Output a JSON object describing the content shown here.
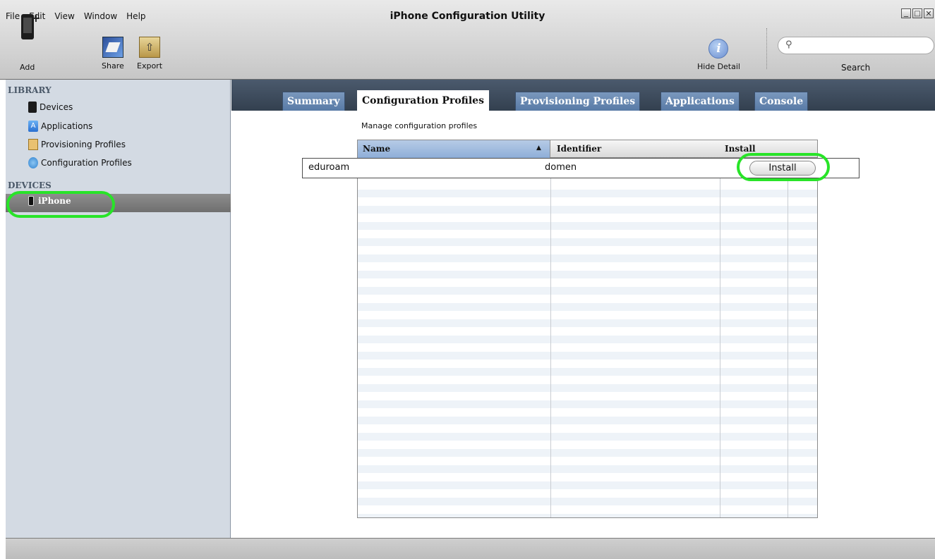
{
  "app": {
    "title": "iPhone Configuration Utility"
  },
  "menu": [
    "File",
    "Edit",
    "View",
    "Window",
    "Help"
  ],
  "toolbar": {
    "add_label": "Add",
    "share_label": "Share",
    "export_label": "Export",
    "hide_detail_label": "Hide Detail",
    "search_label": "Search",
    "search_value": ""
  },
  "sidebar": {
    "library_header": "LIBRARY",
    "library_items": [
      {
        "label": "Devices",
        "icon": "device-icon"
      },
      {
        "label": "Applications",
        "icon": "app-store-icon"
      },
      {
        "label": "Provisioning Profiles",
        "icon": "provisioning-profile-icon"
      },
      {
        "label": "Configuration Profiles",
        "icon": "configuration-profile-icon"
      }
    ],
    "devices_header": "DEVICES",
    "devices": [
      {
        "label": "iPhone",
        "icon": "iphone-icon",
        "selected": true
      }
    ]
  },
  "tabs": [
    {
      "label": "Summary",
      "active": false
    },
    {
      "label": "Configuration Profiles",
      "active": true
    },
    {
      "label": "Provisioning Profiles",
      "active": false
    },
    {
      "label": "Applications",
      "active": false
    },
    {
      "label": "Console",
      "active": false
    }
  ],
  "main": {
    "description": "Manage configuration profiles",
    "columns": [
      "Name",
      "Identifier",
      "Install"
    ],
    "sort": {
      "column": "Name",
      "direction": "ascending"
    },
    "rows": [
      {
        "name": "eduroam",
        "identifier": "domen",
        "action": "Install"
      }
    ]
  },
  "colors": {
    "highlight": "#28e428",
    "tab_active_bg": "#ffffff",
    "tab_bg": "#6688b2",
    "sidebar_bg": "#d3dae3",
    "selection_bg": "#7f7f7f"
  }
}
